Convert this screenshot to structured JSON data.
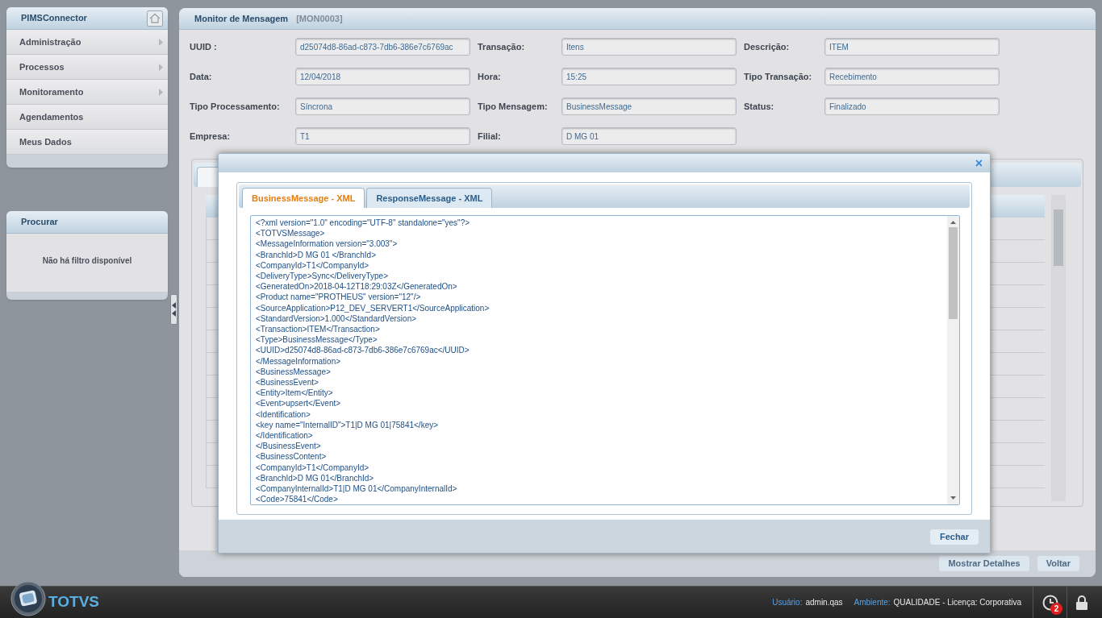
{
  "sidebar": {
    "title": "PIMSConnector",
    "menu": [
      {
        "label": "Administração",
        "has_submenu": true
      },
      {
        "label": "Processos",
        "has_submenu": true
      },
      {
        "label": "Monitoramento",
        "has_submenu": true
      },
      {
        "label": "Agendamentos",
        "has_submenu": false
      },
      {
        "label": "Meus Dados",
        "has_submenu": false
      }
    ]
  },
  "search_panel": {
    "title": "Procurar",
    "message": "Não há filtro disponível"
  },
  "page": {
    "title": "Monitor de Mensagem",
    "code": "[MON0003]",
    "fields": [
      {
        "label": "UUID :",
        "value": "d25074d8-86ad-c873-7db6-386e7c6769ac"
      },
      {
        "label": "Transação:",
        "value": "Itens"
      },
      {
        "label": "Descrição:",
        "value": "ITEM"
      },
      {
        "label": "Data:",
        "value": "12/04/2018"
      },
      {
        "label": "Hora:",
        "value": "15:25"
      },
      {
        "label": "Tipo Transação:",
        "value": "Recebimento"
      },
      {
        "label": "Tipo Processamento:",
        "value": "Síncrona"
      },
      {
        "label": "Tipo Mensagem:",
        "value": "BusinessMessage"
      },
      {
        "label": "Status:",
        "value": "Finalizado"
      },
      {
        "label": "Empresa:",
        "value": "T1"
      },
      {
        "label": "Filial:",
        "value": "D MG 01"
      }
    ],
    "buttons": [
      "Mostrar Detalhes",
      "Voltar"
    ]
  },
  "dialog": {
    "tabs": [
      {
        "label": "BusinessMessage - XML",
        "selected": true
      },
      {
        "label": "ResponseMessage - XML",
        "selected": false
      }
    ],
    "close_icon": "×",
    "xml_lines": [
      "<?xml version=\"1.0\" encoding=\"UTF-8\" standalone=\"yes\"?>",
      "<TOTVSMessage>",
      "<MessageInformation version=\"3.003\">",
      "<BranchId>D MG 01 </BranchId>",
      "<CompanyId>T1</CompanyId>",
      "<DeliveryType>Sync</DeliveryType>",
      "<GeneratedOn>2018-04-12T18:29:03Z</GeneratedOn>",
      "<Product name=\"PROTHEUS\" version=\"12\"/>",
      "<SourceApplication>P12_DEV_SERVERT1</SourceApplication>",
      "<StandardVersion>1.000</StandardVersion>",
      "<Transaction>ITEM</Transaction>",
      "<Type>BusinessMessage</Type>",
      "<UUID>d25074d8-86ad-c873-7db6-386e7c6769ac</UUID>",
      "</MessageInformation>",
      "<BusinessMessage>",
      "<BusinessEvent>",
      "<Entity>Item</Entity>",
      "<Event>upsert</Event>",
      "<Identification>",
      "<key name=\"InternalID\">T1|D MG 01|75841</key>",
      "</Identification>",
      "</BusinessEvent>",
      "<BusinessContent>",
      "<CompanyId>T1</CompanyId>",
      "<BranchId>D MG 01</BranchId>",
      "<CompanyInternalId>T1|D MG 01</CompanyInternalId>",
      "<Code>75841</Code>"
    ],
    "close_button": "Fechar"
  },
  "status_bar": {
    "brand": "TOTVS",
    "user_label": "Usuário:",
    "user": "admin.qas",
    "env_label": "Ambiente:",
    "env": "QUALIDADE - Licença: Corporativa",
    "notifications": "2"
  }
}
